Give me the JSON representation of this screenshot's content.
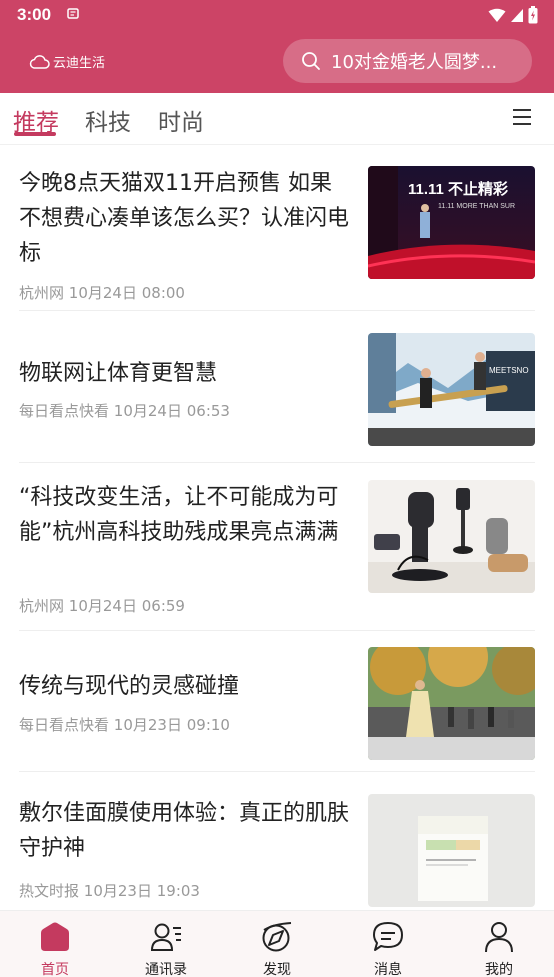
{
  "status_bar": {
    "time": "3:00"
  },
  "header": {
    "brand": "云迪生活",
    "search_text": "10对金婚老人圆梦..."
  },
  "tabs": [
    {
      "label": "推荐",
      "active": true
    },
    {
      "label": "科技",
      "active": false
    },
    {
      "label": "时尚",
      "active": false
    }
  ],
  "articles": [
    {
      "title": "今晚8点天猫双11开启预售 如果不想费心凑单该怎么买？认准闪电标",
      "source": "杭州网",
      "date": "10月24日 08:00",
      "image_text": "11.11 不止精彩",
      "image_subtext": "11.11 MORE THAN SUR"
    },
    {
      "title": "物联网让体育更智慧",
      "source": "每日看点快看",
      "date": "10月24日 06:53",
      "image_text": "MEETSNO"
    },
    {
      "title": "“科技改变生活，让不可能成为可能”杭州高科技助残成果亮点满满",
      "source": "杭州网",
      "date": "10月24日 06:59"
    },
    {
      "title": "传统与现代的灵感碰撞",
      "source": "每日看点快看",
      "date": "10月23日 09:10"
    },
    {
      "title": "敷尔佳面膜使用体验：真正的肌肤守护神",
      "source": "热文时报",
      "date": "10月23日 19:03"
    }
  ],
  "bottom_nav": [
    {
      "label": "首页",
      "icon": "home-icon",
      "active": true
    },
    {
      "label": "通讯录",
      "icon": "contacts-icon",
      "active": false
    },
    {
      "label": "发现",
      "icon": "compass-icon",
      "active": false
    },
    {
      "label": "消息",
      "icon": "message-icon",
      "active": false
    },
    {
      "label": "我的",
      "icon": "profile-icon",
      "active": false
    }
  ],
  "colors": {
    "brand": "#cc4466",
    "accent": "#c43a5f"
  }
}
